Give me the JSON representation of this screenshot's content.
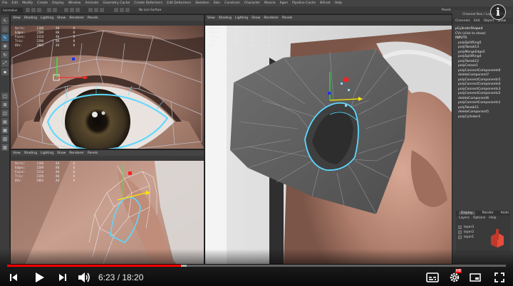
{
  "maya": {
    "menu": [
      "File",
      "Edit",
      "Modify",
      "Create",
      "Display",
      "Window",
      "Animate",
      "Geometry Cache",
      "Create Deformers",
      "Edit Deformers",
      "Skeleton",
      "Skin",
      "Constrain",
      "Character",
      "Muscle",
      "Xgen",
      "Pipeline Cache",
      "Bifrost",
      "Help"
    ],
    "mode_label": "Animation",
    "live_surface": "No Live Surface",
    "panels_label": "Panels"
  },
  "viewport_menu": [
    "View",
    "Shading",
    "Lighting",
    "Show",
    "Renderer",
    "Panels"
  ],
  "hud_keys": [
    "Verts:",
    "Edges:",
    "Faces:",
    "Tris:",
    "UVs:"
  ],
  "hud_values": {
    "top_left": [
      [
        "1188",
        "40",
        "0"
      ],
      [
        "2209",
        "80",
        "0"
      ],
      [
        "1114",
        "40",
        "0"
      ],
      [
        "2196",
        "80",
        "0"
      ],
      [
        "1803",
        "48",
        "0"
      ]
    ],
    "bottom_left": [
      [
        "1188",
        "40",
        "0"
      ],
      [
        "2209",
        "80",
        "0"
      ],
      [
        "1114",
        "40",
        "0"
      ],
      [
        "2196",
        "80",
        "0"
      ],
      [
        "1803",
        "48",
        "0"
      ]
    ],
    "right": [
      [
        "427",
        "88",
        "0"
      ],
      [
        "833",
        "88",
        "0"
      ],
      [
        "58",
        "42",
        "0"
      ],
      [
        "814",
        "82",
        "0"
      ],
      [
        "71",
        "40",
        "0"
      ]
    ]
  },
  "channel_box": {
    "header": "Channel Box / Layer Editor",
    "tabs": [
      "Channels",
      "Edit",
      "Object",
      "Show"
    ],
    "object_name": "pCylinderShape4",
    "cvs_hint": "CVs (click to show)",
    "inputs_label": "INPUTS",
    "inputs": [
      "polySplitRing5",
      "polyTweak13",
      "polyMergeEdge5",
      "polySplitRing4",
      "polyTweak12",
      "polyCrease1",
      "polyConnectComponents6",
      "deleteComponent7",
      "polyConnectComponents5",
      "polyConnectComponents4",
      "polyConnectComponents3",
      "polyConnectComponents2",
      "deleteComponent6",
      "polyConnectComponents1",
      "polyTweak11",
      "deleteComponent5",
      "polyCylinder4"
    ]
  },
  "layers": {
    "tabs": [
      "Display",
      "Render",
      "Anim"
    ],
    "menu": [
      "Layers",
      "Options",
      "Help"
    ],
    "items": [
      "layer3",
      "layer2",
      "layer1"
    ]
  },
  "player": {
    "time_display": "6:23 / 18:20",
    "current_seconds": 383,
    "duration_seconds": 1100,
    "buffered_fraction": 0.36,
    "hd_badge": "HD",
    "progress_color": "#ff0000"
  },
  "icons": [
    "info-icon",
    "play-icon",
    "prev-icon",
    "next-icon",
    "volume-icon",
    "subtitles-icon",
    "settings-icon",
    "miniplayer-icon",
    "theater-icon",
    "fullscreen-icon"
  ]
}
